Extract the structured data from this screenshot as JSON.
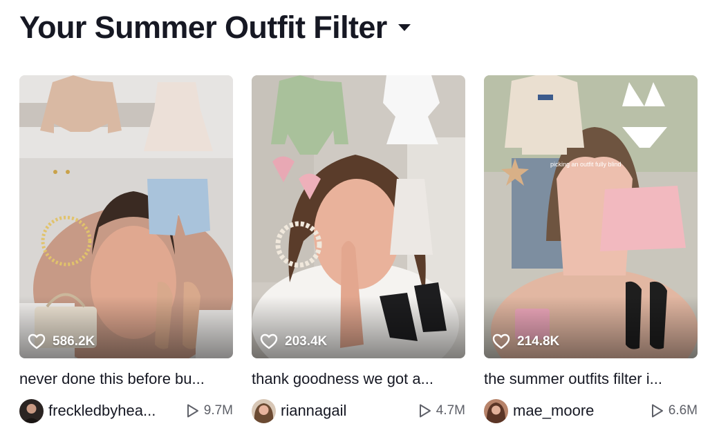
{
  "header": {
    "title": "Your Summer Outfit Filter",
    "dropdown_icon": "caret-down-icon"
  },
  "videos": [
    {
      "likes": "586.2K",
      "caption": "never done this before bu...",
      "author": "freckledbyhea...",
      "plays": "9.7M"
    },
    {
      "likes": "203.4K",
      "caption": "thank goodness we got a...",
      "author": "riannagail",
      "plays": "4.7M"
    },
    {
      "likes": "214.8K",
      "caption": "the summer outfits filter i...",
      "author": "mae_moore",
      "plays": "6.6M",
      "overlay_text": "picking an outfit fully blind"
    }
  ],
  "icons": {
    "likes": "heart-icon",
    "plays": "play-icon"
  },
  "colors": {
    "text_primary": "#161823",
    "text_secondary": "#5e6068",
    "background": "#ffffff"
  }
}
